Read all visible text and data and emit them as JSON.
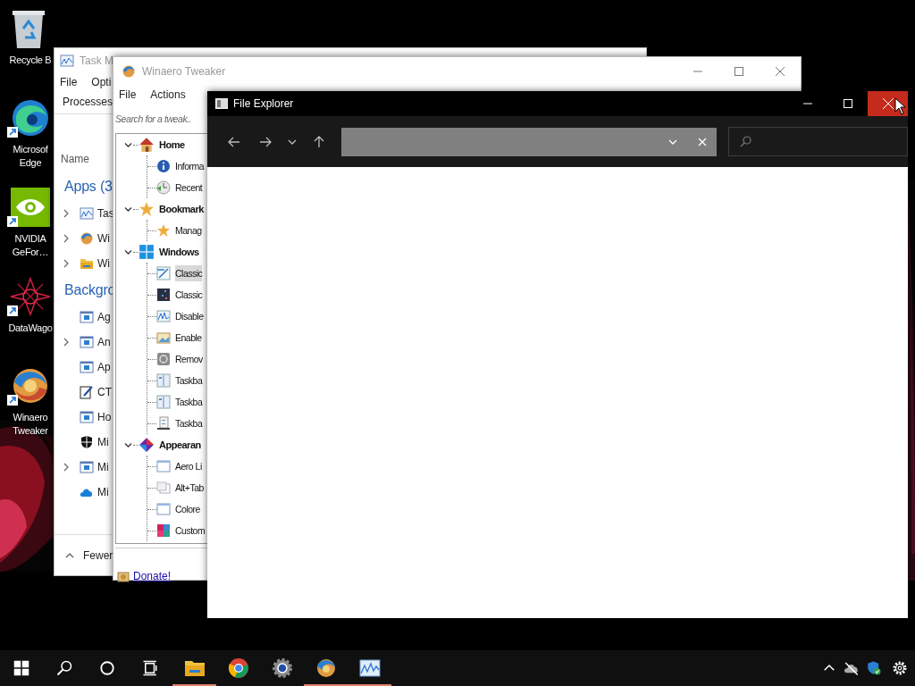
{
  "desktop_icons": [
    {
      "kind": "recycle",
      "label": "Recycle B",
      "shortcut": false
    },
    {
      "kind": "edge",
      "label": "Microsof\nEdge",
      "shortcut": true
    },
    {
      "kind": "nvidia",
      "label": "NVIDIA\nGeFor…",
      "shortcut": true
    },
    {
      "kind": "datawagon",
      "label": "DataWago",
      "shortcut": true
    },
    {
      "kind": "winaero",
      "label": "Winaero\nTweaker",
      "shortcut": true
    }
  ],
  "task_manager": {
    "title": "Task M",
    "menu": [
      "File",
      "Opti"
    ],
    "tabs": [
      {
        "label": "Processes",
        "selected": true
      }
    ],
    "columns": [
      "Name"
    ],
    "groups": [
      {
        "label": "Apps (3",
        "rows": [
          {
            "kind": "taskmgr",
            "label": "Tas",
            "expandable": true
          },
          {
            "kind": "winaero",
            "label": "Wi",
            "expandable": true
          },
          {
            "kind": "folder",
            "label": "Wi",
            "expandable": true
          }
        ]
      },
      {
        "label": "Backgro",
        "rows": [
          {
            "kind": "service",
            "label": "Ag",
            "expandable": false
          },
          {
            "kind": "service",
            "label": "An",
            "expandable": true
          },
          {
            "kind": "service",
            "label": "Ap",
            "expandable": false
          },
          {
            "kind": "notepad",
            "label": "CT",
            "expandable": false
          },
          {
            "kind": "service",
            "label": "Ho",
            "expandable": false
          },
          {
            "kind": "shield",
            "label": "Mi",
            "expandable": false
          },
          {
            "kind": "service",
            "label": "Mi",
            "expandable": true
          },
          {
            "kind": "cloud",
            "label": "Mi",
            "expandable": false
          }
        ]
      }
    ],
    "footer": "Fewer"
  },
  "winaero_tweaker": {
    "title": "Winaero Tweaker",
    "menu": [
      "File",
      "Actions"
    ],
    "search": {
      "placeholder": "Search for a tweak.."
    },
    "tree": [
      {
        "kind": "house",
        "label": "Home",
        "expanded": true,
        "selected": false,
        "children": [
          {
            "kind": "info",
            "label": "Informa",
            "selected": false
          },
          {
            "kind": "clock",
            "label": "Recent",
            "selected": false
          }
        ]
      },
      {
        "kind": "star",
        "label": "Bookmark",
        "expanded": true,
        "selected": false,
        "children": [
          {
            "kind": "star",
            "label": "Manag",
            "selected": false
          }
        ]
      },
      {
        "kind": "windows",
        "label": "Windows",
        "expanded": true,
        "selected": false,
        "children": [
          {
            "kind": "pen",
            "label": "Classic",
            "selected": true
          },
          {
            "kind": "dark",
            "label": "Classic",
            "selected": false
          },
          {
            "kind": "chart",
            "label": "Disable",
            "selected": false
          },
          {
            "kind": "frame",
            "label": "Enable",
            "selected": false
          },
          {
            "kind": "disc",
            "label": "Remov",
            "selected": false
          },
          {
            "kind": "panel",
            "label": "Taskba",
            "selected": false
          },
          {
            "kind": "panel",
            "label": "Taskba",
            "selected": false
          },
          {
            "kind": "list",
            "label": "Taskba",
            "selected": false
          }
        ]
      },
      {
        "kind": "palette",
        "label": "Appearan",
        "expanded": true,
        "selected": false,
        "children": [
          {
            "kind": "window",
            "label": "Aero Li",
            "selected": false
          },
          {
            "kind": "window2",
            "label": "Alt+Tab",
            "selected": false
          },
          {
            "kind": "window",
            "label": "Colore",
            "selected": false
          },
          {
            "kind": "colors",
            "label": "Custom",
            "selected": false
          }
        ]
      }
    ],
    "footer_link": "Donate!"
  },
  "file_explorer": {
    "title": "File Explorer"
  },
  "taskbar": {
    "apps": [
      {
        "kind": "explorer",
        "running": true
      },
      {
        "kind": "chrome",
        "running": false
      },
      {
        "kind": "settings",
        "running": false
      },
      {
        "kind": "winaero",
        "running": true
      },
      {
        "kind": "taskmgr",
        "running": true
      }
    ]
  }
}
